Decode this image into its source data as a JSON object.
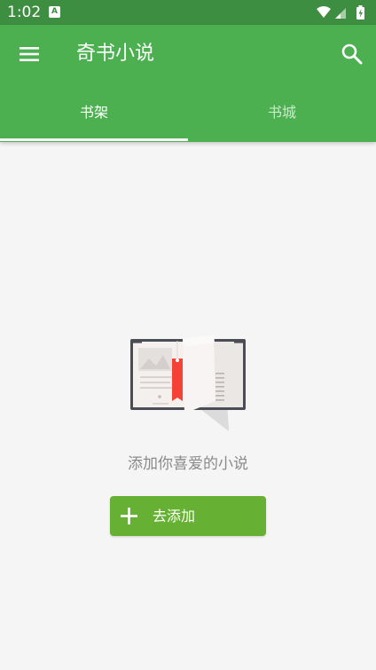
{
  "status_bar": {
    "time": "1:02",
    "notification_icon": "A",
    "icons": [
      "wifi-icon",
      "signal-icon",
      "battery-icon"
    ]
  },
  "app_bar": {
    "title": "奇书小说",
    "menu_icon": "menu-icon",
    "search_icon": "search-icon",
    "color": "#4caf50"
  },
  "tabs": [
    {
      "label": "书架",
      "selected": true
    },
    {
      "label": "书城",
      "selected": false
    }
  ],
  "empty_state": {
    "illustration": "open-book-icon",
    "message": "添加你喜爱的小说",
    "add_button_label": "去添加",
    "add_icon": "plus-icon",
    "button_color": "#66b033"
  }
}
